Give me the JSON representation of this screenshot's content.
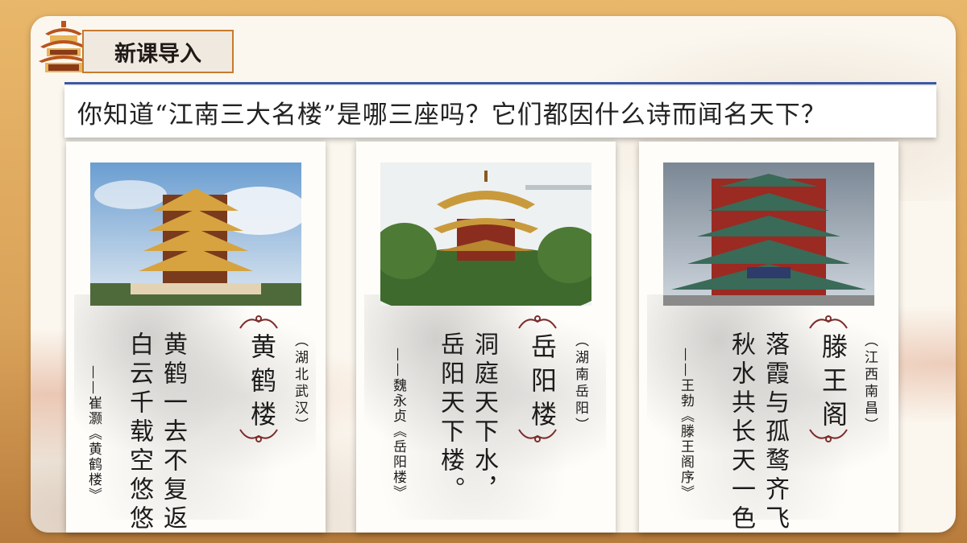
{
  "header": {
    "title": "新课导入",
    "question": "你知道“江南三大名楼”是哪三座吗？它们都因什么诗而闻名天下？"
  },
  "cards": [
    {
      "name": "黄鹤楼",
      "location": "（湖北武汉）",
      "poem_lines": [
        "黄鹤一去不复返，",
        "白云千载空悠悠"
      ],
      "source": "——崔灏《黄鹤楼》",
      "image": "yellow-crane-tower-photo"
    },
    {
      "name": "岳阳楼",
      "location": "（湖南岳阳）",
      "poem_lines": [
        "洞庭天下水，",
        "岳阳天下楼。"
      ],
      "source": "——魏永贞《岳阳楼》",
      "image": "yueyang-tower-photo"
    },
    {
      "name": "滕王阁",
      "location": "（江西南昌）",
      "poem_lines": [
        "落霞与孤鹜齐飞，",
        "秋水共长天一色。"
      ],
      "source": "——王勃《滕王阁序》",
      "image": "tengwang-pavilion-photo"
    }
  ],
  "colors": {
    "accent_blue": "#3a5aa8",
    "title_border": "#c87a2c",
    "frame": "#d9a25a"
  }
}
